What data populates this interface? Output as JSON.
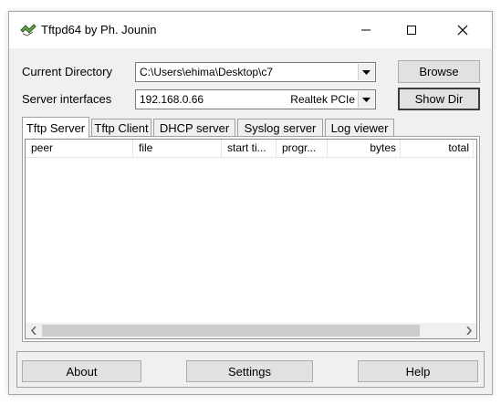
{
  "window": {
    "title": "Tftpd64 by Ph. Jounin"
  },
  "controls": {
    "current_directory_label": "Current Directory",
    "current_directory_value": "C:\\Users\\ehima\\Desktop\\c7",
    "server_interfaces_label": "Server interfaces",
    "server_ip": "192.168.0.66",
    "server_adapter": "Realtek PCIe",
    "browse_label": "Browse",
    "show_dir_label": "Show Dir"
  },
  "tabs": [
    {
      "label": "Tftp Server",
      "active": true
    },
    {
      "label": "Tftp Client",
      "active": false
    },
    {
      "label": "DHCP server",
      "active": false
    },
    {
      "label": "Syslog server",
      "active": false
    },
    {
      "label": "Log viewer",
      "active": false
    }
  ],
  "list": {
    "columns": [
      "peer",
      "file",
      "start ti...",
      "progr...",
      "bytes",
      "total"
    ],
    "rows": []
  },
  "footer": {
    "about_label": "About",
    "settings_label": "Settings",
    "help_label": "Help"
  }
}
